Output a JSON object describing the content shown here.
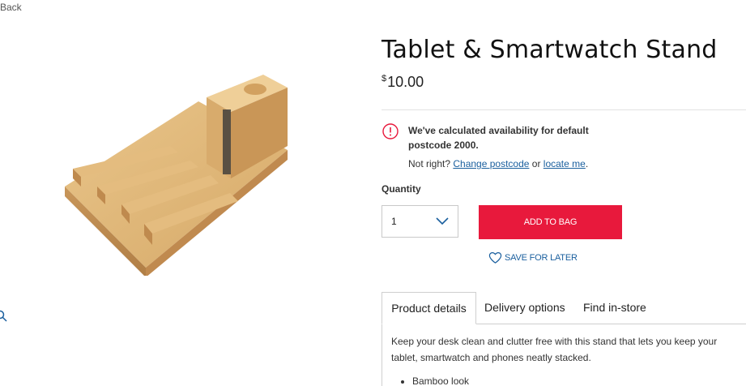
{
  "nav": {
    "back_label": "Back"
  },
  "product": {
    "title": "Tablet & Smartwatch Stand",
    "price_currency": "$",
    "price_amount": "10.00",
    "image_icon": "bamboo-stand-photo"
  },
  "availability": {
    "message": "We've calculated availability for default postcode 2000.",
    "not_right_prefix": "Not right? ",
    "change_postcode_label": "Change postcode",
    "or_text": " or ",
    "locate_me_label": "locate me",
    "period": ".",
    "alert_color": "#e8193c"
  },
  "purchase": {
    "quantity_label": "Quantity",
    "quantity_value": "1",
    "add_to_bag_label": "ADD TO BAG",
    "save_for_later_label": "SAVE FOR LATER",
    "accent_color": "#e8193c",
    "link_color": "#1a5f9e"
  },
  "tabs": [
    {
      "label": "Product details",
      "active": true
    },
    {
      "label": "Delivery options",
      "active": false
    },
    {
      "label": "Find in-store",
      "active": false
    }
  ],
  "details": {
    "description": "Keep your desk clean and clutter free with this stand that lets you keep your tablet, smartwatch and phones neatly stacked.",
    "features": [
      "Bamboo look"
    ]
  }
}
